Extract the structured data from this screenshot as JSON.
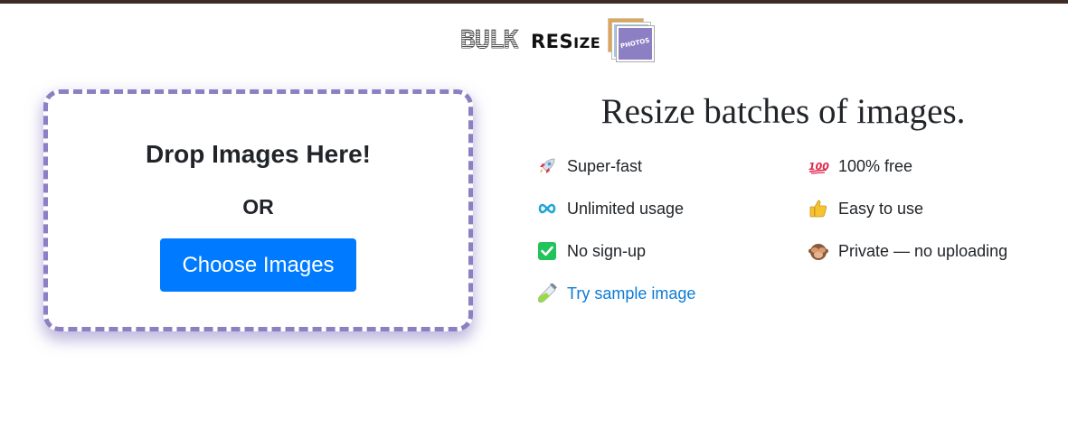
{
  "logo": {
    "word1": "BULK",
    "word2_big": "RES",
    "word2_small": "IZE",
    "badge": "PHOTOS"
  },
  "dropzone": {
    "title": "Drop Images Here!",
    "or": "OR",
    "button": "Choose Images"
  },
  "headline": "Resize batches of images.",
  "features": {
    "super_fast": "Super-fast",
    "free": "100% free",
    "unlimited": "Unlimited usage",
    "easy": "Easy to use",
    "no_signup": "No sign-up",
    "private": "Private — no uploading",
    "sample": "Try sample image"
  },
  "icons": {
    "super_fast": "rocket-icon",
    "free": "hundred-points-icon",
    "unlimited": "infinity-icon",
    "easy": "thumbs-up-icon",
    "no_signup": "check-mark-icon",
    "private": "see-no-evil-monkey-icon",
    "sample": "test-tube-icon"
  },
  "colors": {
    "accent_purple": "#8d7fc3",
    "button_blue": "#007bff",
    "link_blue": "#0d7bd6",
    "top_bar": "#3e2b25"
  }
}
